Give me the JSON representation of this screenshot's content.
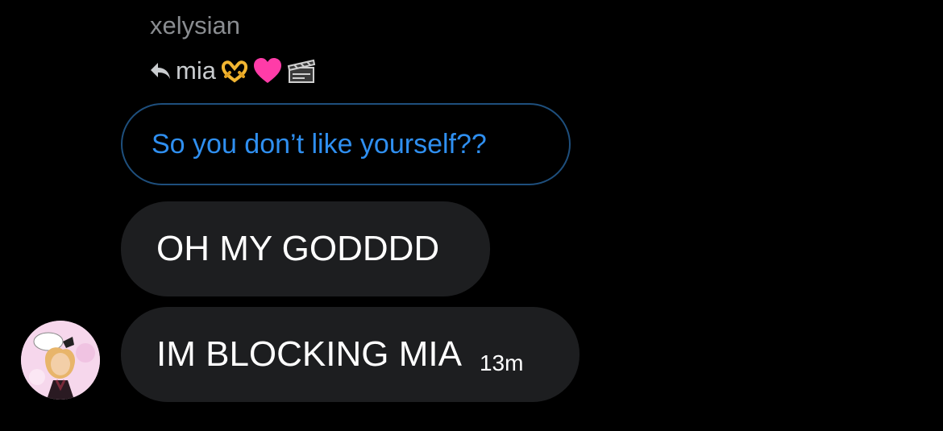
{
  "message": {
    "sender": "xelysian",
    "reply": {
      "to_label": "mia",
      "emojis": [
        "heart-hands",
        "pink-heart",
        "clapper-board"
      ],
      "quoted_text": "So you don’t like yourself??"
    },
    "bubbles": [
      {
        "text": "OH MY GODDDD"
      },
      {
        "text": "IM BLOCKING MIA",
        "time": "13m"
      }
    ]
  },
  "colors": {
    "background": "#000000",
    "bubble": "#1d1e20",
    "quoted_border": "#1e4f7d",
    "quoted_text": "#2f8ff0",
    "sender_text": "#8a8d91"
  },
  "icons": {
    "reply_arrow": "reply-arrow-icon",
    "avatar": "user-avatar"
  }
}
